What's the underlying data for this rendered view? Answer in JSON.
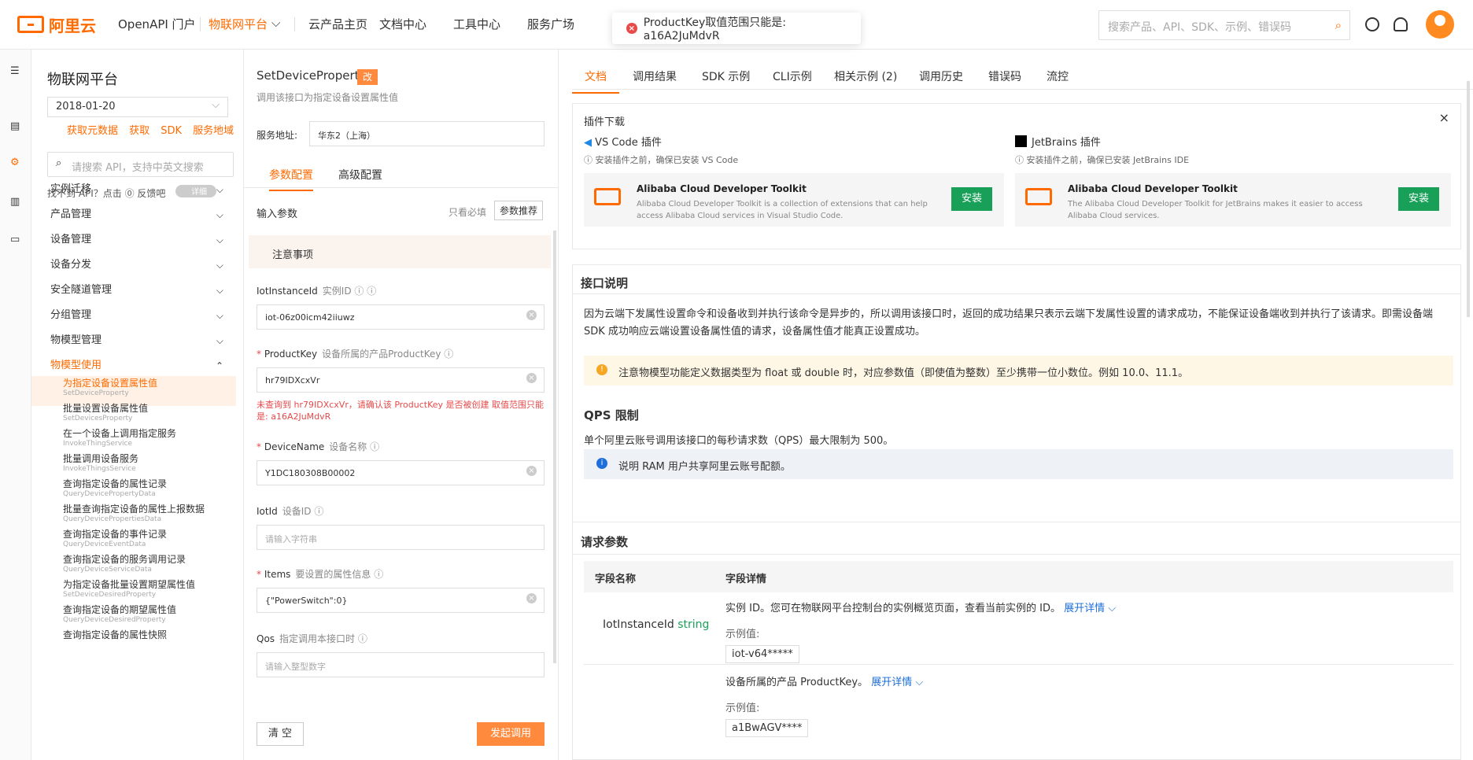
{
  "top": {
    "brand": "阿里云",
    "nav": [
      "OpenAPI 门户",
      "物联网平台",
      "云产品主页",
      "文档中心",
      "工具中心",
      "服务广场"
    ],
    "search_placeholder": "搜索产品、API、SDK、示例、错误码",
    "toast": "ProductKey取值范围只能是: a16A2JuMdvR"
  },
  "side": {
    "title": "物联网平台",
    "version": "2018-01-20",
    "links": "获取元数据 获取 SDK 服务地域",
    "search": "请搜索 API，支持中英文搜索",
    "tip": "找不到 API？点击 ⓪ 反馈吧",
    "toggle": "详细",
    "menus": [
      "实例迁移",
      "产品管理",
      "设备管理",
      "设备分发",
      "安全隧道管理",
      "分组管理",
      "物模型管理",
      "物模型使用"
    ],
    "subs": [
      [
        "为指定设备设置属性值",
        "SetDeviceProperty"
      ],
      [
        "批量设置设备属性值",
        "SetDevicesProperty"
      ],
      [
        "在一个设备上调用指定服务",
        "InvokeThingService"
      ],
      [
        "批量调用设备服务",
        "InvokeThingsService"
      ],
      [
        "查询指定设备的属性记录",
        "QueryDevicePropertyData"
      ],
      [
        "批量查询指定设备的属性上报数据",
        "QueryDevicePropertiesData"
      ],
      [
        "查询指定设备的事件记录",
        "QueryDeviceEventData"
      ],
      [
        "查询指定设备的服务调用记录",
        "QueryDeviceServiceData"
      ],
      [
        "为指定设备批量设置期望属性值",
        "SetDeviceDesiredProperty"
      ],
      [
        "查询指定设备的期望属性值",
        "QueryDeviceDesiredProperty"
      ],
      [
        "查询指定设备的属性快照",
        ""
      ]
    ]
  },
  "mid": {
    "title": "SetDeviceProperty",
    "badge": "改",
    "desc": "调用该接口为指定设备设置属性值",
    "svc_label": "服务地址:",
    "svc_value": "华东2（上海）",
    "tab1": "参数配置",
    "tab2": "高级配置",
    "input_params": "输入参数",
    "required_only": "只看必填",
    "recommend": "参数推荐",
    "note": "注意事项",
    "f1": {
      "label": "IotInstanceId",
      "hint": "实例ID ⓘ ⓘ",
      "value": "iot-06z00icm42iiuwz"
    },
    "f2": {
      "label": "ProductKey",
      "hint": "设备所属的产品ProductKey ⓘ",
      "value": "hr79IDXcxVr"
    },
    "err": "未查询到 hr79IDXcxVr，请确认该 ProductKey 是否被创建 取值范围只能是: a16A2JuMdvR",
    "f3": {
      "label": "DeviceName",
      "hint": "设备名称 ⓘ",
      "value": "Y1DC180308B00002"
    },
    "f4": {
      "label": "IotId",
      "hint": "设备ID ⓘ",
      "placeholder": "请输入字符串"
    },
    "f5": {
      "label": "Items",
      "hint": "要设置的属性信息 ⓘ",
      "value": "{\"PowerSwitch\":0}"
    },
    "f6": {
      "label": "Qos",
      "hint": "指定调用本接口时 ⓘ",
      "placeholder": "请输入整型数字"
    },
    "clear": "清 空",
    "call": "发起调用"
  },
  "right": {
    "tabs": [
      "文档",
      "调用结果",
      "SDK 示例",
      "CLI示例",
      "相关示例 (2)",
      "调用历史",
      "错误码",
      "流控"
    ],
    "plugin": "插件下载",
    "vscode": "VS Code 插件",
    "jb": "JetBrains 插件",
    "vs_note": "ⓘ 安装插件之前，确保已安装 VS Code",
    "jb_note": "ⓘ 安装插件之前，确保已安装 JetBrains IDE",
    "card_title": "Alibaba Cloud Developer Toolkit",
    "card1": "Alibaba Cloud Developer Toolkit is a collection of extensions that can help access Alibaba Cloud services in Visual Studio Code.",
    "card2": "The Alibaba Cloud Developer Toolkit for JetBrains makes it easier to access Alibaba Cloud services.",
    "install": "安装",
    "api_title": "接口说明",
    "api_text": "因为云端下发属性设置命令和设备收到并执行该命令是异步的，所以调用该接口时，返回的成功结果只表示云端下发属性设置的请求成功，不能保证设备端收到并执行了该请求。即需设备端 SDK 成功响应云端设置设备属性值的请求，设备属性值才能真正设置成功。",
    "warn": "注意物模型功能定义数据类型为 float 或 double 时，对应参数值（即使值为整数）至少携带一位小数位。例如 10.0、11.1。",
    "qps_title": "QPS 限制",
    "qps_text": "单个阿里云账号调用该接口的每秒请求数（QPS）最大限制为 500。",
    "info": "说明 RAM 用户共享阿里云账号配额。",
    "req_title": "请求参数",
    "col1": "字段名称",
    "col2": "字段详情",
    "p1_name": "IotInstanceId",
    "p1_type": "string",
    "p1_desc": "实例 ID。您可在物联网平台控制台的实例概览页面，查看当前实例的 ID。",
    "expand": "展开详情 ⌵",
    "example": "示例值:",
    "p1_ex": "iot-v64*****",
    "p2_desc": "设备所属的产品 ProductKey。",
    "p2_ex": "a1BwAGV****"
  }
}
